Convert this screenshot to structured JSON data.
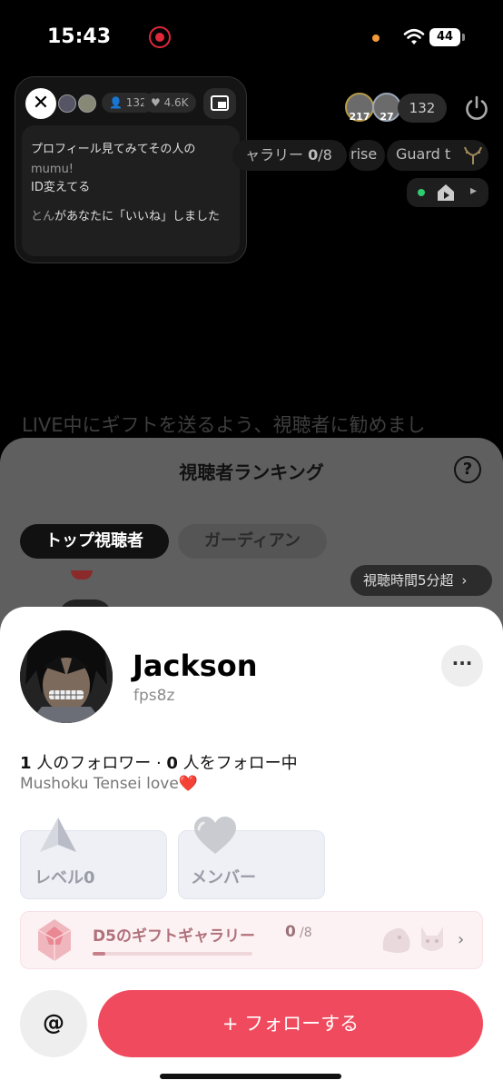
{
  "status_bar": {
    "time": "15:43",
    "battery": "44"
  },
  "pip": {
    "viewers": "132",
    "likes": "4.6K",
    "message_line1": "プロフィール見てみてその人の",
    "message_user": "mumu!",
    "message_line2": "ID変えてる",
    "like_user": "とん",
    "like_text": "があなたに「いいね」しました"
  },
  "live": {
    "avatar_badges": [
      "217",
      "27"
    ],
    "viewer_count": "132",
    "gallery_ticker": "ャラリー",
    "gallery_count": "0",
    "gallery_total": "/8",
    "rise_label": "rise",
    "guard_label": "Guard t",
    "hint": "LIVE中にギフトを送るよう、視聴者に勧めまし"
  },
  "ranking": {
    "title": "視聴者ランキング",
    "help": "?",
    "tab_top": "トップ視聴者",
    "tab_guardian": "ガーディアン",
    "watch_time": "視聴時間5分超",
    "watch_chevron": "›"
  },
  "profile": {
    "name": "Jackson",
    "handle": "fps8z",
    "more": "···",
    "followers_num": "1",
    "followers_text": " 人のフォロワー · ",
    "following_num": "0",
    "following_text": " 人をフォロー中",
    "bio": "Mushoku Tensei love",
    "bio_emoji": "❤️",
    "level_label": "レベル0",
    "member_label": "メンバー",
    "gift_title": "D5のギフトギャラリー",
    "gift_count": "0",
    "gift_total": "/8",
    "gift_progress": 0.08,
    "mention": "@",
    "follow_button": "+ フォローする"
  },
  "colors": {
    "accent": "#ef4a5d",
    "record": "#e0283a",
    "sheet": "#ffffff",
    "overlay": "#5f5f5f"
  }
}
